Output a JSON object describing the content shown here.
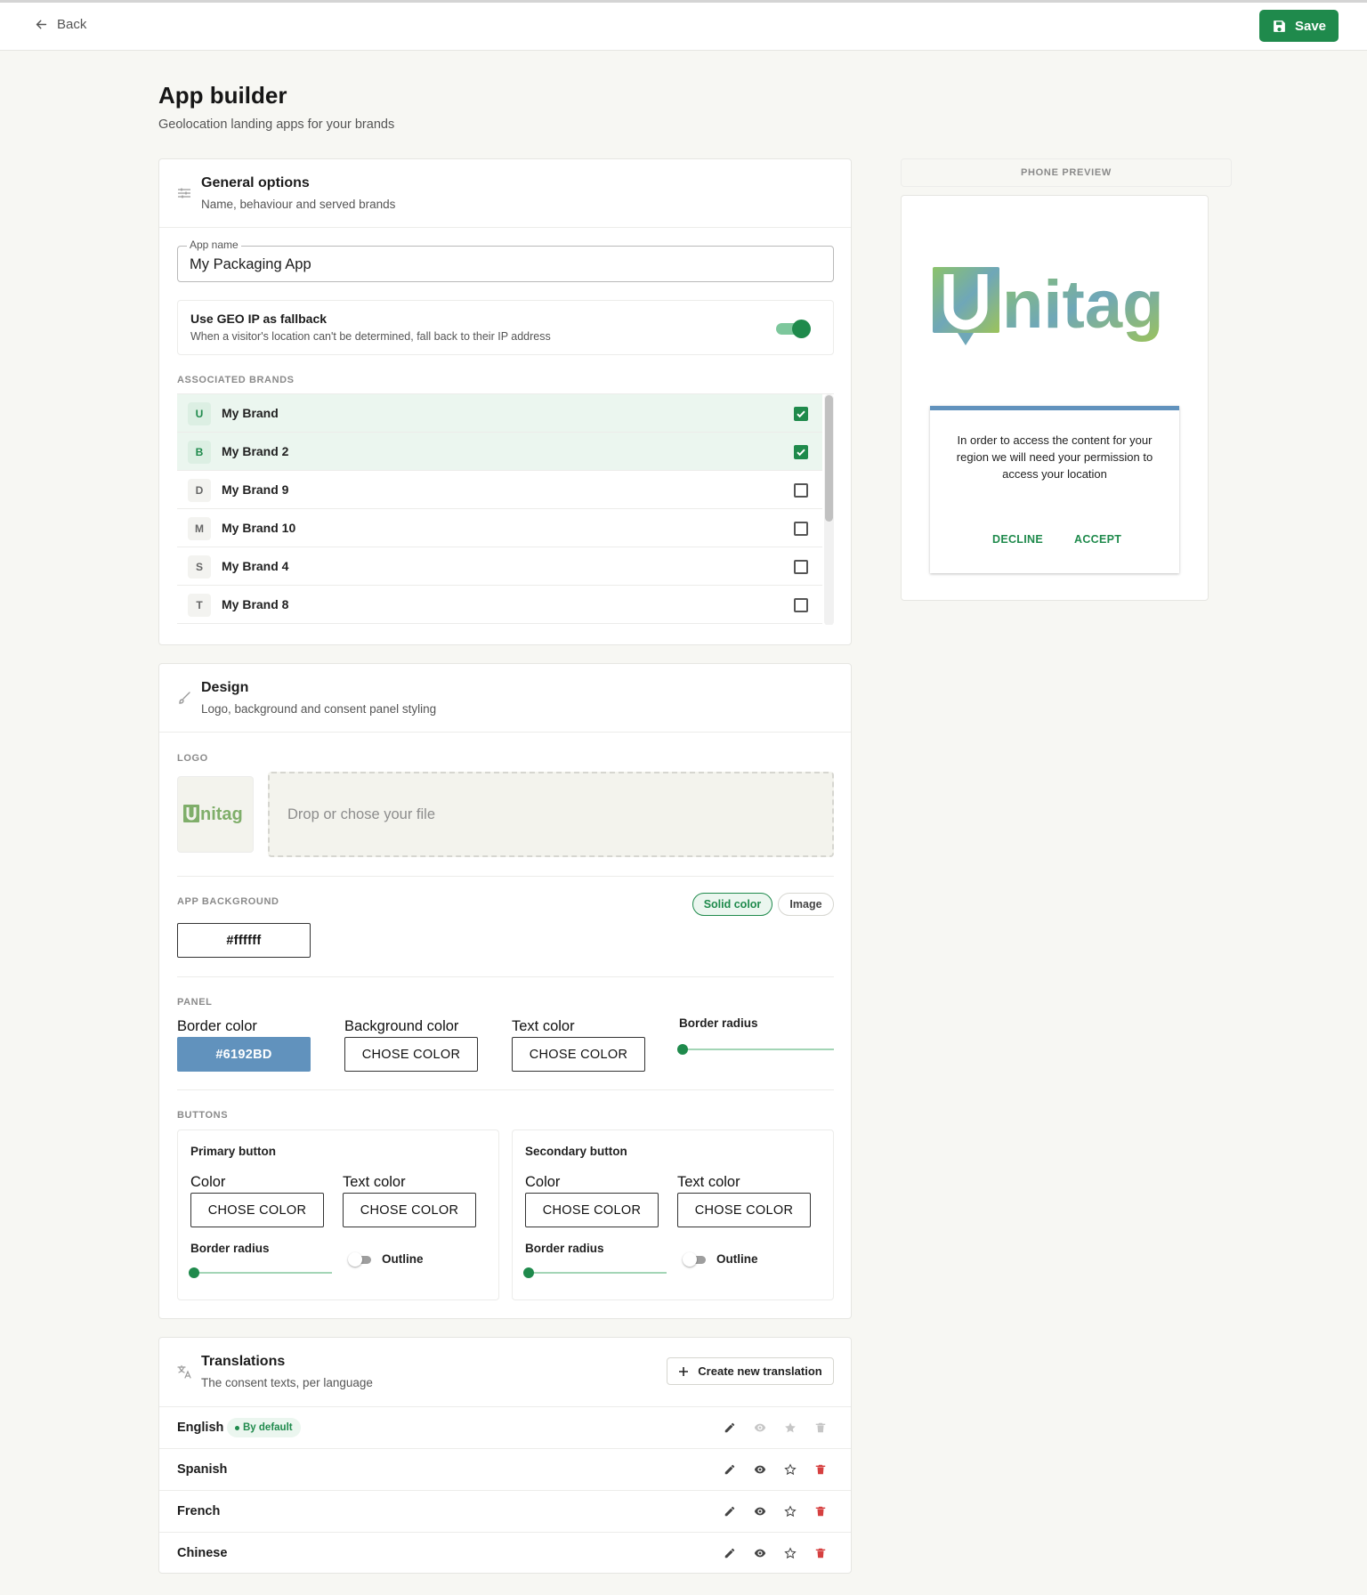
{
  "topbar": {
    "back_label": "Back",
    "save_label": "Save"
  },
  "page": {
    "title": "App builder",
    "subtitle": "Geolocation landing apps for your brands"
  },
  "general": {
    "title": "General options",
    "subtitle": "Name, behaviour and served brands",
    "app_name_label": "App name",
    "app_name_value": "My Packaging App",
    "geo_title": "Use GEO IP as fallback",
    "geo_sub": "When a visitor's location can't be determined, fall back to their IP address",
    "geo_enabled": true,
    "brands_label": "Associated brands",
    "brands": [
      {
        "initial": "U",
        "name": "My Brand",
        "checked": true
      },
      {
        "initial": "B",
        "name": "My Brand 2",
        "checked": true
      },
      {
        "initial": "D",
        "name": "My Brand 9",
        "checked": false
      },
      {
        "initial": "M",
        "name": "My Brand 10",
        "checked": false
      },
      {
        "initial": "S",
        "name": "My Brand 4",
        "checked": false
      },
      {
        "initial": "T",
        "name": "My Brand 8",
        "checked": false
      }
    ]
  },
  "design": {
    "title": "Design",
    "subtitle": "Logo, background and consent panel styling",
    "logo_label": "Logo",
    "logo_text": "nitag",
    "dropzone_text": "Drop or chose your file",
    "background_label": "App background",
    "bg_mode_solid": "Solid color",
    "bg_mode_image": "Image",
    "bg_color": "#ffffff",
    "panel_label": "Panel",
    "panel": {
      "border_color_label": "Border color",
      "border_color_value": "#6192BD",
      "background_color_label": "Background color",
      "background_color_value": "CHOSE COLOR",
      "text_color_label": "Text color",
      "text_color_value": "CHOSE COLOR",
      "border_radius_label": "Border radius"
    },
    "buttons_label": "Buttons",
    "primary": {
      "title": "Primary button",
      "color_label": "Color",
      "color_value": "CHOSE COLOR",
      "text_color_label": "Text color",
      "text_color_value": "CHOSE COLOR",
      "radius_label": "Border radius",
      "outline_label": "Outline"
    },
    "secondary": {
      "title": "Secondary button",
      "color_label": "Color",
      "color_value": "CHOSE COLOR",
      "text_color_label": "Text color",
      "text_color_value": "CHOSE COLOR",
      "radius_label": "Border radius",
      "outline_label": "Outline"
    }
  },
  "translations": {
    "title": "Translations",
    "subtitle": "The consent texts, per language",
    "create_label": "Create new translation",
    "default_badge": "By default",
    "languages": [
      {
        "name": "English",
        "is_default": true
      },
      {
        "name": "Spanish",
        "is_default": false
      },
      {
        "name": "French",
        "is_default": false
      },
      {
        "name": "Chinese",
        "is_default": false
      }
    ]
  },
  "preview": {
    "label": "Phone preview",
    "logo_text": "nitag",
    "consent_text": "In order to access the content for your region we will need your permission to access your location",
    "decline_label": "DECLINE",
    "accept_label": "ACCEPT"
  },
  "colors": {
    "accent": "#1f8a4c",
    "panel_border": "#6192bd",
    "danger": "#d64040"
  }
}
